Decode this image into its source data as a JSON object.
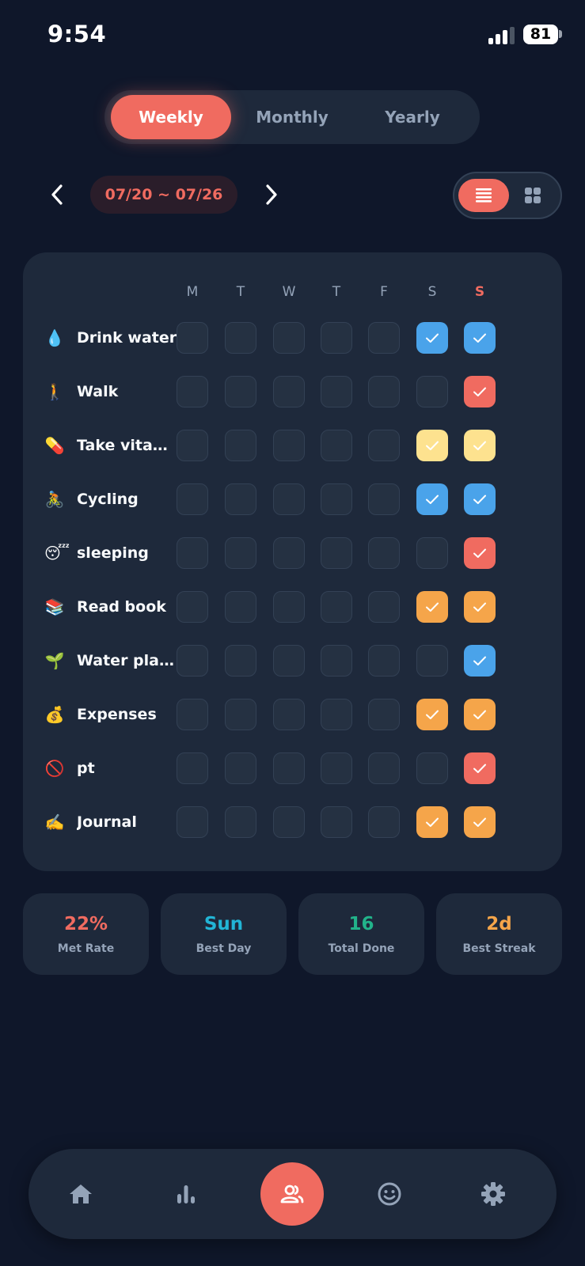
{
  "status": {
    "time": "9:54",
    "battery": "81"
  },
  "tabs": [
    "Weekly",
    "Monthly",
    "Yearly"
  ],
  "date_range": "07/20 ~ 07/26",
  "days": [
    "M",
    "T",
    "W",
    "T",
    "F",
    "S",
    "S"
  ],
  "habits": [
    {
      "icon": "💧",
      "name": "Drink water",
      "done": [
        0,
        0,
        0,
        0,
        0,
        1,
        1
      ],
      "color": [
        "",
        "",
        "",
        "",
        "",
        "#4aa3ea",
        "#4aa3ea"
      ]
    },
    {
      "icon": "🚶",
      "name": "Walk",
      "done": [
        0,
        0,
        0,
        0,
        0,
        0,
        1
      ],
      "color": [
        "",
        "",
        "",
        "",
        "",
        "",
        "#f06b60"
      ]
    },
    {
      "icon": "💊",
      "name": "Take vitamins",
      "done": [
        0,
        0,
        0,
        0,
        0,
        1,
        1
      ],
      "color": [
        "",
        "",
        "",
        "",
        "",
        "#fde28f",
        "#fde28f"
      ]
    },
    {
      "icon": "🚴",
      "name": "Cycling",
      "done": [
        0,
        0,
        0,
        0,
        0,
        1,
        1
      ],
      "color": [
        "",
        "",
        "",
        "",
        "",
        "#4aa3ea",
        "#4aa3ea"
      ]
    },
    {
      "icon": "😴",
      "name": "sleeping",
      "done": [
        0,
        0,
        0,
        0,
        0,
        0,
        1
      ],
      "color": [
        "",
        "",
        "",
        "",
        "",
        "",
        "#f06b60"
      ]
    },
    {
      "icon": "📚",
      "name": "Read book",
      "done": [
        0,
        0,
        0,
        0,
        0,
        1,
        1
      ],
      "color": [
        "",
        "",
        "",
        "",
        "",
        "#f5a54a",
        "#f5a54a"
      ]
    },
    {
      "icon": "🌱",
      "name": "Water plants",
      "done": [
        0,
        0,
        0,
        0,
        0,
        0,
        1
      ],
      "color": [
        "",
        "",
        "",
        "",
        "",
        "",
        "#4aa3ea"
      ]
    },
    {
      "icon": "💰",
      "name": "Expenses",
      "done": [
        0,
        0,
        0,
        0,
        0,
        1,
        1
      ],
      "color": [
        "",
        "",
        "",
        "",
        "",
        "#f5a54a",
        "#f5a54a"
      ]
    },
    {
      "icon": "🚫",
      "name": "pt",
      "done": [
        0,
        0,
        0,
        0,
        0,
        0,
        1
      ],
      "color": [
        "",
        "",
        "",
        "",
        "",
        "",
        "#f06b60"
      ]
    },
    {
      "icon": "✍️",
      "name": "Journal",
      "done": [
        0,
        0,
        0,
        0,
        0,
        1,
        1
      ],
      "color": [
        "",
        "",
        "",
        "",
        "",
        "#f5a54a",
        "#f5a54a"
      ]
    }
  ],
  "stats": [
    {
      "value": "22%",
      "label": "Met Rate",
      "color": "#f06b60"
    },
    {
      "value": "Sun",
      "label": "Best Day",
      "color": "#22b5d6"
    },
    {
      "value": "16",
      "label": "Total Done",
      "color": "#22b38a"
    },
    {
      "value": "2d",
      "label": "Best Streak",
      "color": "#f5a54a"
    }
  ],
  "colors": {
    "accent": "#f06b60",
    "background": "#0f172a",
    "card": "#1e293b"
  },
  "nav": [
    {
      "icon": "home-icon"
    },
    {
      "icon": "bar-chart-icon"
    },
    {
      "icon": "people-icon"
    },
    {
      "icon": "smiley-icon"
    },
    {
      "icon": "gear-icon"
    }
  ]
}
